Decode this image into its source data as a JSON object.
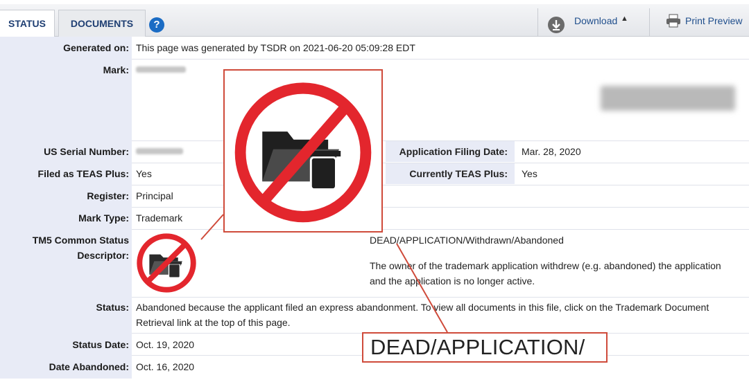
{
  "tabs": {
    "status": "STATUS",
    "documents": "DOCUMENTS",
    "help": "?"
  },
  "toolbar": {
    "download": "Download",
    "download_caret": "▲",
    "print_preview": "Print Preview"
  },
  "fields": {
    "generated_on": {
      "label": "Generated on:",
      "value": "This page was generated by TSDR on 2021-06-20 05:09:28 EDT"
    },
    "mark": {
      "label": "Mark:"
    },
    "serial": {
      "label": "US Serial Number:"
    },
    "filing_date": {
      "label": "Application Filing Date:",
      "value": "Mar. 28, 2020"
    },
    "teas_plus": {
      "label": "Filed as TEAS Plus:",
      "value": "Yes"
    },
    "current_teas": {
      "label": "Currently TEAS Plus:",
      "value": "Yes"
    },
    "register": {
      "label": "Register:",
      "value": "Principal"
    },
    "mark_type": {
      "label": "Mark Type:",
      "value": "Trademark"
    },
    "tm5": {
      "label_line1": "TM5 Common Status",
      "label_line2": "Descriptor:",
      "descriptor": "DEAD/APPLICATION/Withdrawn/Abandoned",
      "desc_line1": "The owner of the trademark application withdrew (e.g. abandoned) the application",
      "desc_line2": "and the application is no longer active."
    },
    "status": {
      "label": "Status:",
      "line1": "Abandoned because the applicant filed an express abandonment. To view all documents in this file, click on the Trademark Document",
      "line2": "Retrieval link at the top of this page."
    },
    "status_date": {
      "label": "Status Date:",
      "value": "Oct. 19, 2020"
    },
    "date_abandoned": {
      "label": "Date Abandoned:",
      "value": "Oct. 16, 2020"
    }
  },
  "callout_text": "DEAD/APPLICATION/",
  "colors": {
    "accent": "#1f3f73",
    "callout": "#cf4a3a",
    "prohibit": "#e3262d",
    "label_bg": "#e8ebf6"
  },
  "icons": [
    "help-icon",
    "download-icon",
    "printer-icon",
    "no-folder-trash-icon"
  ]
}
